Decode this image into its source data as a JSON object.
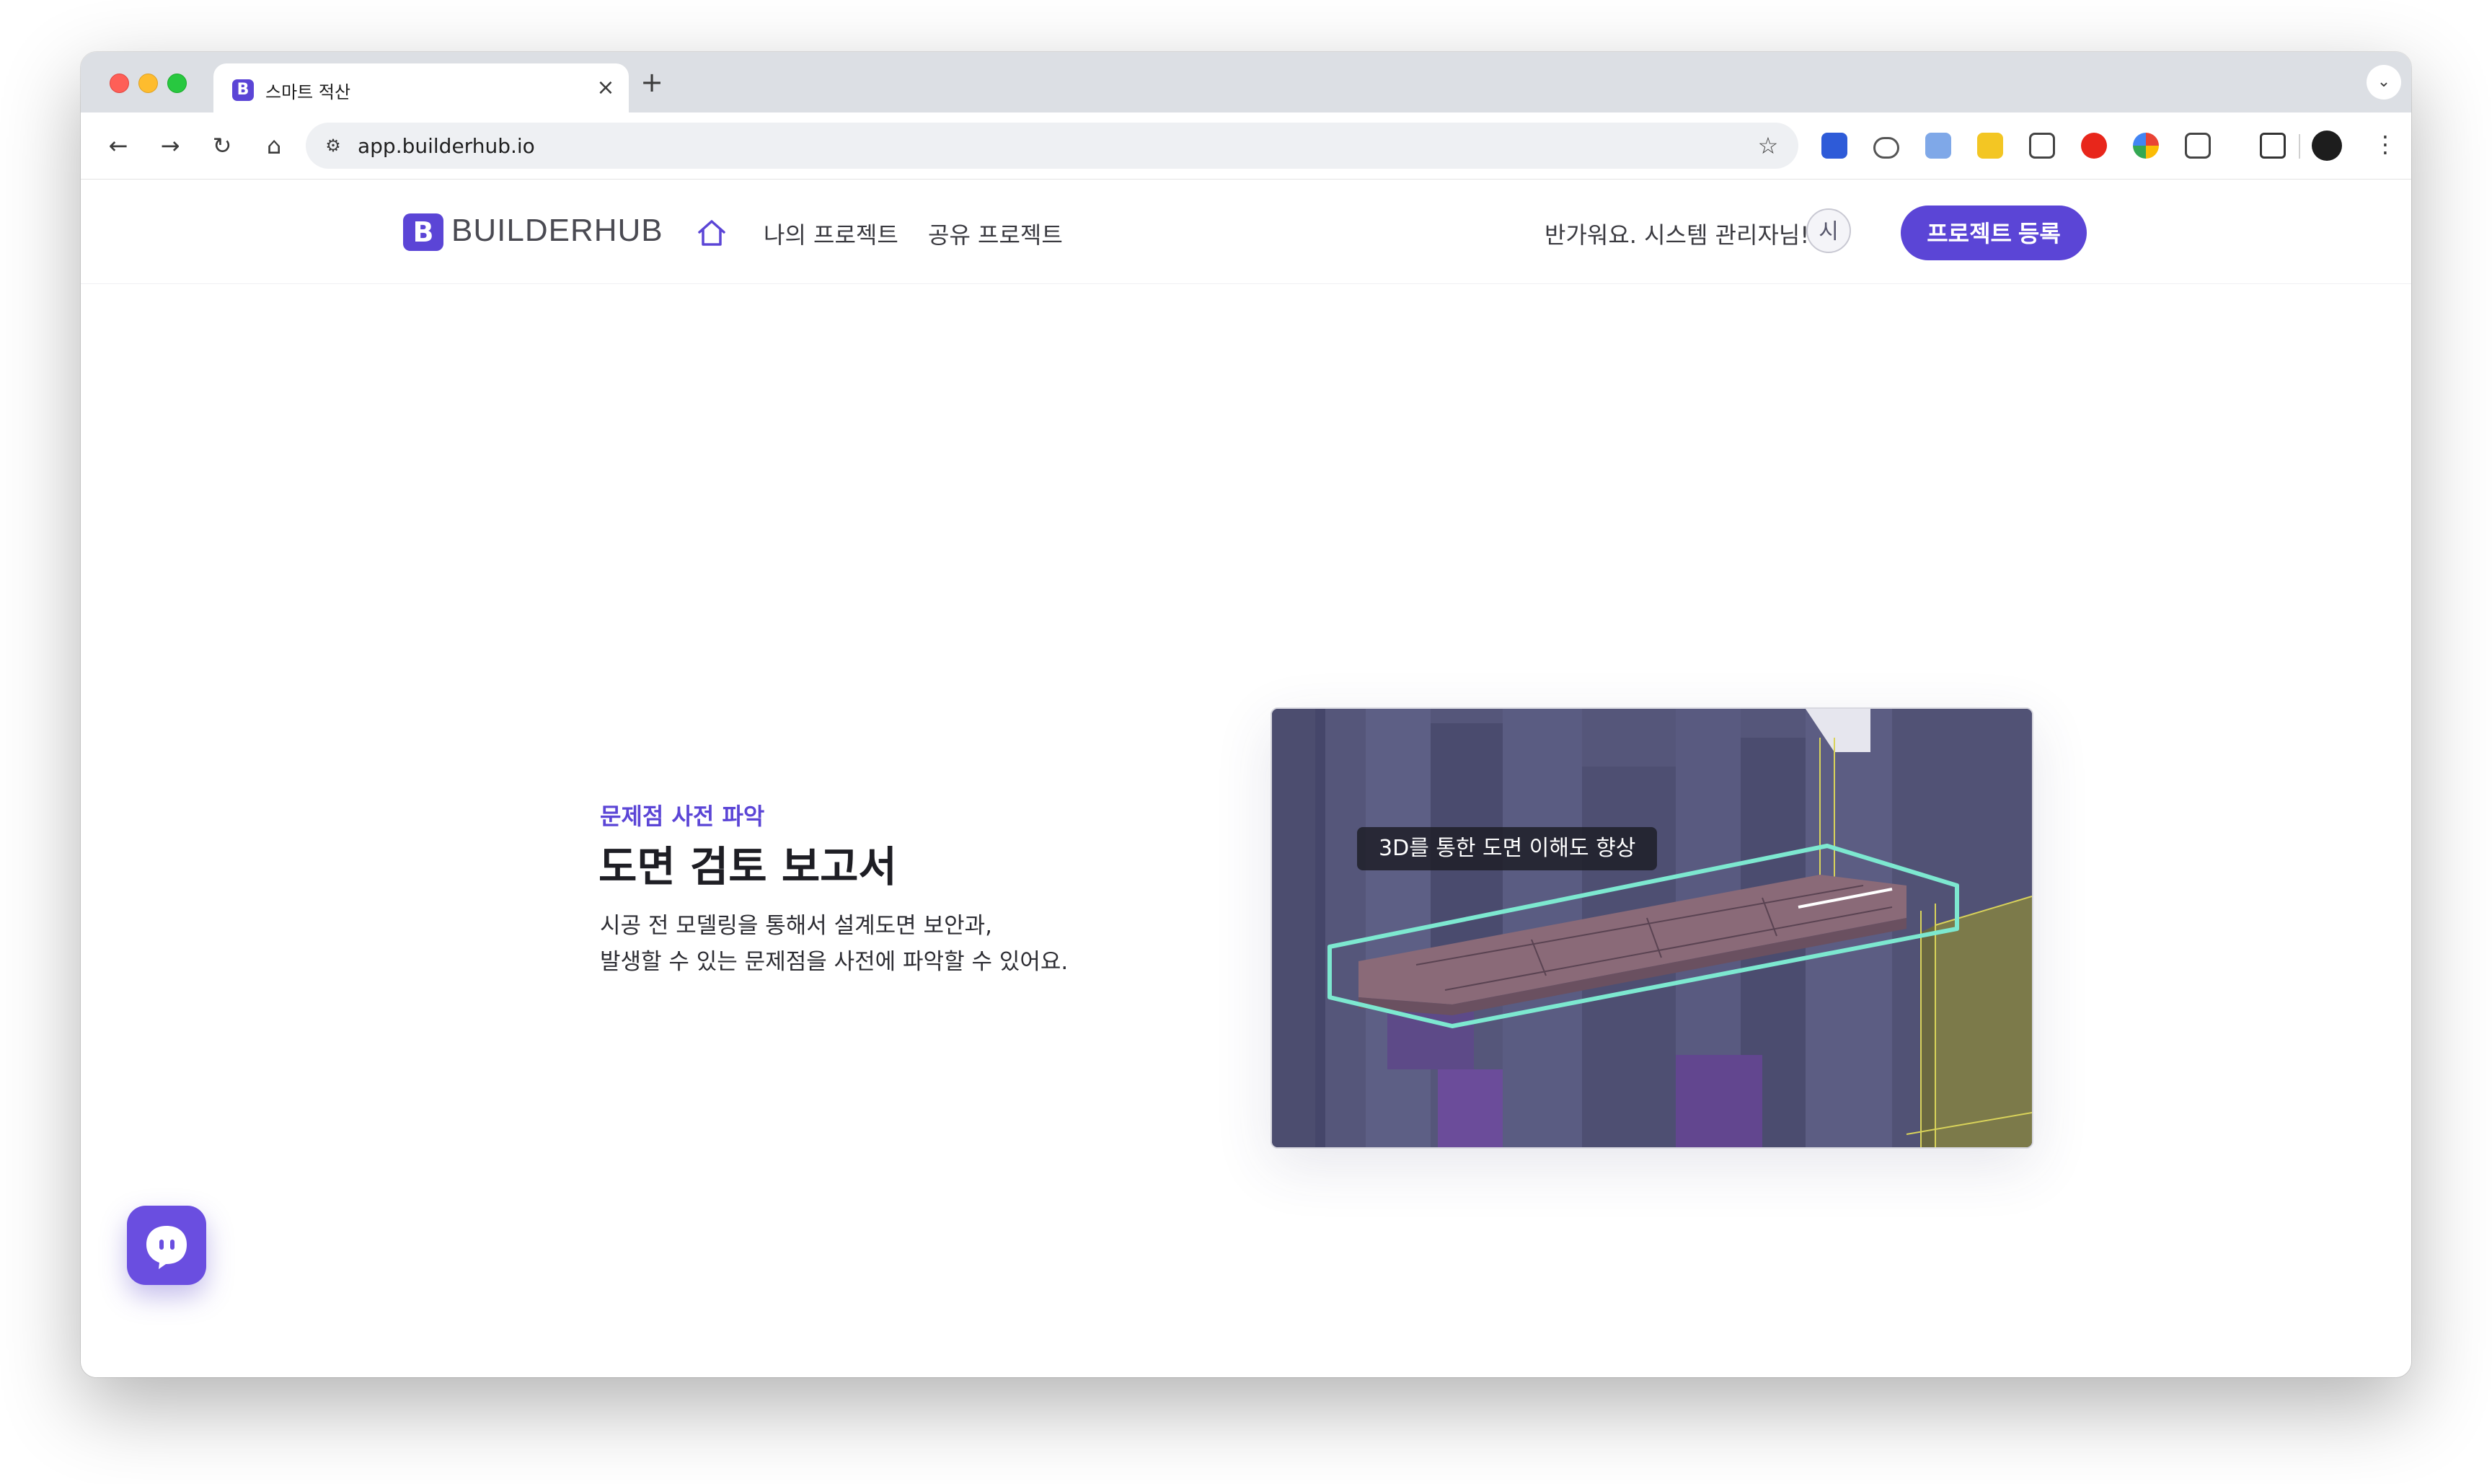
{
  "browser": {
    "tab_title": "스마트 적산",
    "favicon_letter": "B",
    "url": "app.builderhub.io",
    "icons": [
      "back-icon",
      "forward-icon",
      "reload-icon",
      "home-icon",
      "site-settings-icon",
      "bookmark-star-icon",
      "extensions-icon",
      "sidepanel-icon",
      "profile-icon",
      "menu-icon"
    ]
  },
  "header": {
    "logo_mark": "B",
    "logo_text": "BUILDERHUB",
    "nav": {
      "my_projects": "나의 프로젝트",
      "shared_projects": "공유 프로젝트"
    },
    "greeting": "반가워요. 시스템 관리자님!",
    "avatar_initial": "시",
    "cta_label": "프로젝트 등록"
  },
  "hero": {
    "eyebrow": "문제점 사전 파악",
    "title": "도면 검토 보고서",
    "description_line1": "시공 전 모델링을 통해서 설계도면 보안과,",
    "description_line2": "발생할 수 있는 문제점을 사전에 파악할 수 있어요.",
    "image_caption": "3D를 통한 도면 이해도 향상"
  },
  "colors": {
    "brand": "#5b45d6",
    "highlight_outline": "#7de8d0",
    "model_wall": "#55567a",
    "model_beam": "#8a6a78",
    "model_olive": "#7c7a4a"
  }
}
